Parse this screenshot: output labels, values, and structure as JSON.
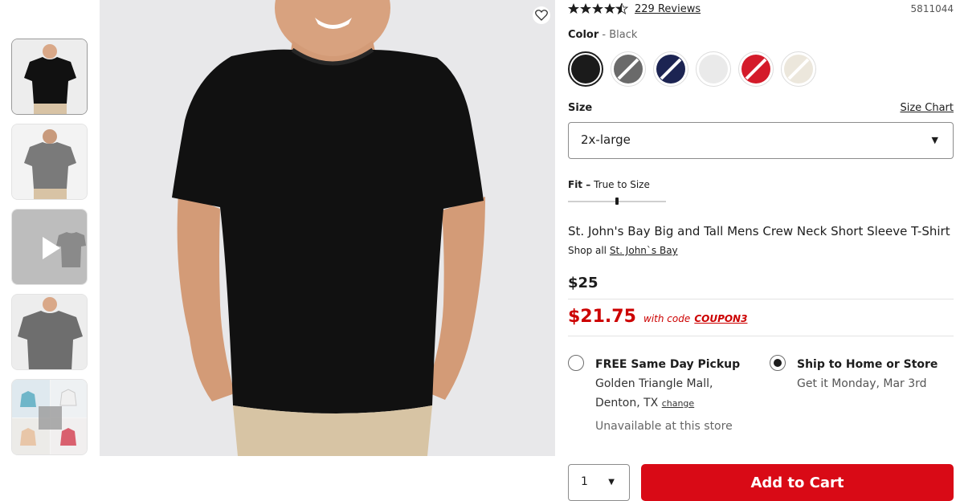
{
  "product": {
    "rating_stars": "★★★★★",
    "reviews_label": "229 Reviews",
    "sku": "5811044",
    "title": "St. John's Bay Big and Tall Mens Crew Neck Short Sleeve T-Shirt",
    "shop_all_prefix": "Shop all",
    "brand_link": "St. John`s Bay",
    "price": "$25",
    "sale_price": "$21.75",
    "sale_with_code": "with code",
    "coupon_code": "COUPON3"
  },
  "color": {
    "label": "Color",
    "separator": " - ",
    "selected": "Black",
    "swatches": [
      {
        "name": "black",
        "color": "#1b1b1b",
        "available": true,
        "selected": true
      },
      {
        "name": "charcoal",
        "color": "#6a6a6a",
        "available": false
      },
      {
        "name": "navy",
        "color": "#1c2452",
        "available": false
      },
      {
        "name": "white",
        "color": "#eaeaea",
        "available": true
      },
      {
        "name": "red",
        "color": "#d41b2a",
        "available": false
      },
      {
        "name": "ivory",
        "color": "#ece7dc",
        "available": false
      }
    ]
  },
  "size": {
    "label": "Size",
    "chart_link": "Size Chart",
    "selected": "2x-large"
  },
  "fit": {
    "label": "Fit –",
    "value": "True to Size",
    "level": 0.5
  },
  "fulfillment": {
    "pickup": {
      "title": "FREE Same Day Pickup",
      "store": "Golden Triangle Mall,",
      "city": "Denton, TX",
      "change_link": "change",
      "status": "Unavailable at this store",
      "selected": false
    },
    "ship": {
      "title": "Ship to Home or Store",
      "eta": "Get it Monday, Mar 3rd",
      "selected": true
    }
  },
  "cart": {
    "quantity": "1",
    "add_label": "Add to Cart"
  },
  "colors": {
    "accent_red": "#d90a16",
    "sale_red": "#cc0000"
  },
  "icons": {
    "favorite": "heart-outline-icon",
    "play": "play-icon",
    "dropdown": "caret-down-icon"
  }
}
